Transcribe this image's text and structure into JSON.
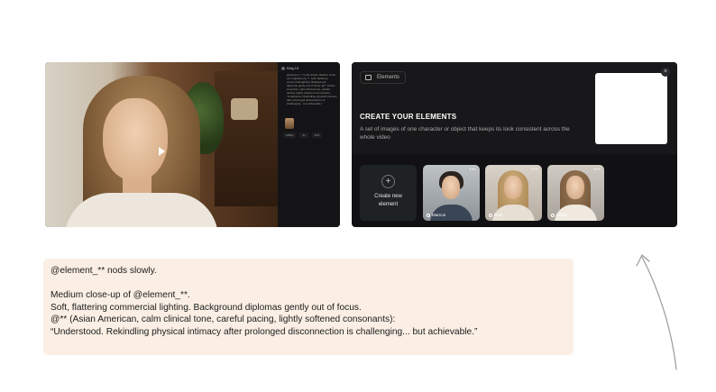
{
  "video_panel": {
    "side_title": "Kling 2.6",
    "side_text": "@element_** nods slowly. Medium close-up of @element_**. Soft, flattering commercial lighting. Background diplomas gently out of focus. @** (Asian American, calm clinical tone, careful pacing, lightly softened consonants): “Understood. Rekindling physical intimacy after prolonged disconnection is challenging... but achievable.”",
    "chips": [
      "1080p",
      "4s",
      "16:9"
    ]
  },
  "elements_panel": {
    "tab_label": "Elements",
    "title": "CREATE YOUR ELEMENTS",
    "description": "A set of images of one character or object that keeps its look consistent across the whole video",
    "create_label_line1": "Create new",
    "create_label_line2": "element",
    "more_label": "•••",
    "elements": [
      {
        "name": "Marcus"
      },
      {
        "name": "linda"
      },
      {
        "name": "Ethan"
      }
    ]
  },
  "prompt": {
    "line1": "@element_** nods slowly.",
    "line2": "Medium close-up of @element_**.",
    "line3": "Soft, flattering commercial lighting. Background diplomas gently out of focus.",
    "line4": "@** (Asian American, calm clinical tone, careful pacing, lightly softened consonants):",
    "line5": "“Understood. Rekindling physical intimacy after prolonged disconnection is challenging... but achievable.”"
  }
}
